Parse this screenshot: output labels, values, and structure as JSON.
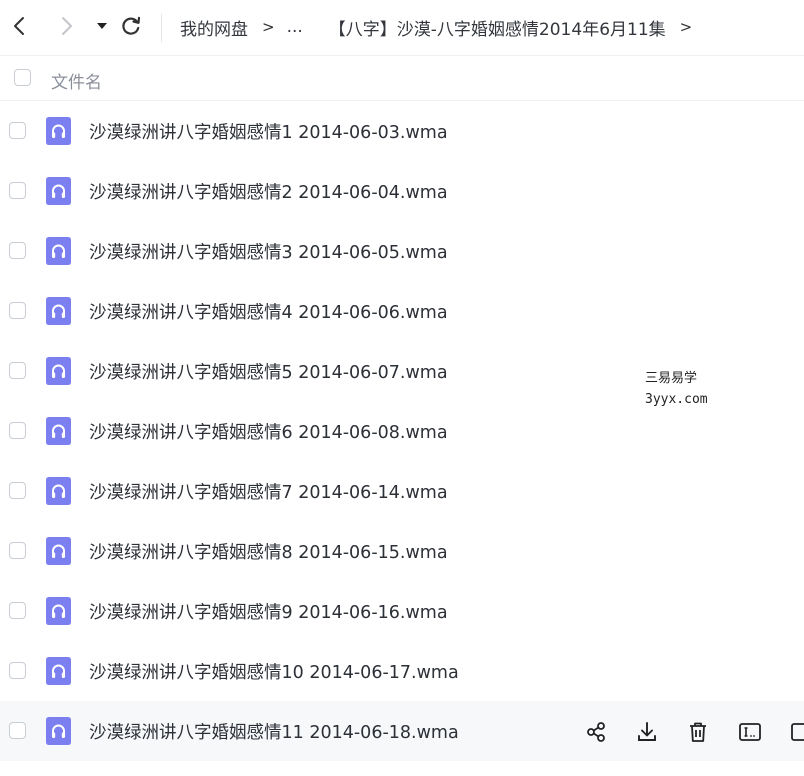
{
  "toolbar": {
    "back_icon": "chevron-left-icon",
    "forward_icon": "chevron-right-icon",
    "history_icon": "caret-down-icon",
    "refresh_icon": "refresh-icon"
  },
  "breadcrumb": {
    "root": "我的网盘",
    "ellipsis": "...",
    "current": "【八字】沙漠-八字婚姻感情2014年6月11集",
    "separator": ">"
  },
  "header": {
    "name_column": "文件名"
  },
  "files": [
    {
      "name": "沙漠绿洲讲八字婚姻感情1 2014-06-03.wma",
      "icon": "audio-file-icon"
    },
    {
      "name": "沙漠绿洲讲八字婚姻感情2 2014-06-04.wma",
      "icon": "audio-file-icon"
    },
    {
      "name": "沙漠绿洲讲八字婚姻感情3 2014-06-05.wma",
      "icon": "audio-file-icon"
    },
    {
      "name": "沙漠绿洲讲八字婚姻感情4 2014-06-06.wma",
      "icon": "audio-file-icon"
    },
    {
      "name": "沙漠绿洲讲八字婚姻感情5 2014-06-07.wma",
      "icon": "audio-file-icon"
    },
    {
      "name": "沙漠绿洲讲八字婚姻感情6 2014-06-08.wma",
      "icon": "audio-file-icon"
    },
    {
      "name": "沙漠绿洲讲八字婚姻感情7 2014-06-14.wma",
      "icon": "audio-file-icon"
    },
    {
      "name": "沙漠绿洲讲八字婚姻感情8 2014-06-15.wma",
      "icon": "audio-file-icon"
    },
    {
      "name": "沙漠绿洲讲八字婚姻感情9 2014-06-16.wma",
      "icon": "audio-file-icon"
    },
    {
      "name": "沙漠绿洲讲八字婚姻感情10 2014-06-17.wma",
      "icon": "audio-file-icon"
    },
    {
      "name": "沙漠绿洲讲八字婚姻感情11 2014-06-18.wma",
      "icon": "audio-file-icon"
    }
  ],
  "watermark": {
    "line1": "三易易学",
    "line2": "3yyx.com"
  },
  "row_actions": [
    "share-icon",
    "download-icon",
    "delete-icon",
    "rename-icon",
    "more-icon"
  ],
  "colors": {
    "accent": "#7b7ff0",
    "hover_row": "#f7f8fa",
    "text": "#2b2f36"
  }
}
